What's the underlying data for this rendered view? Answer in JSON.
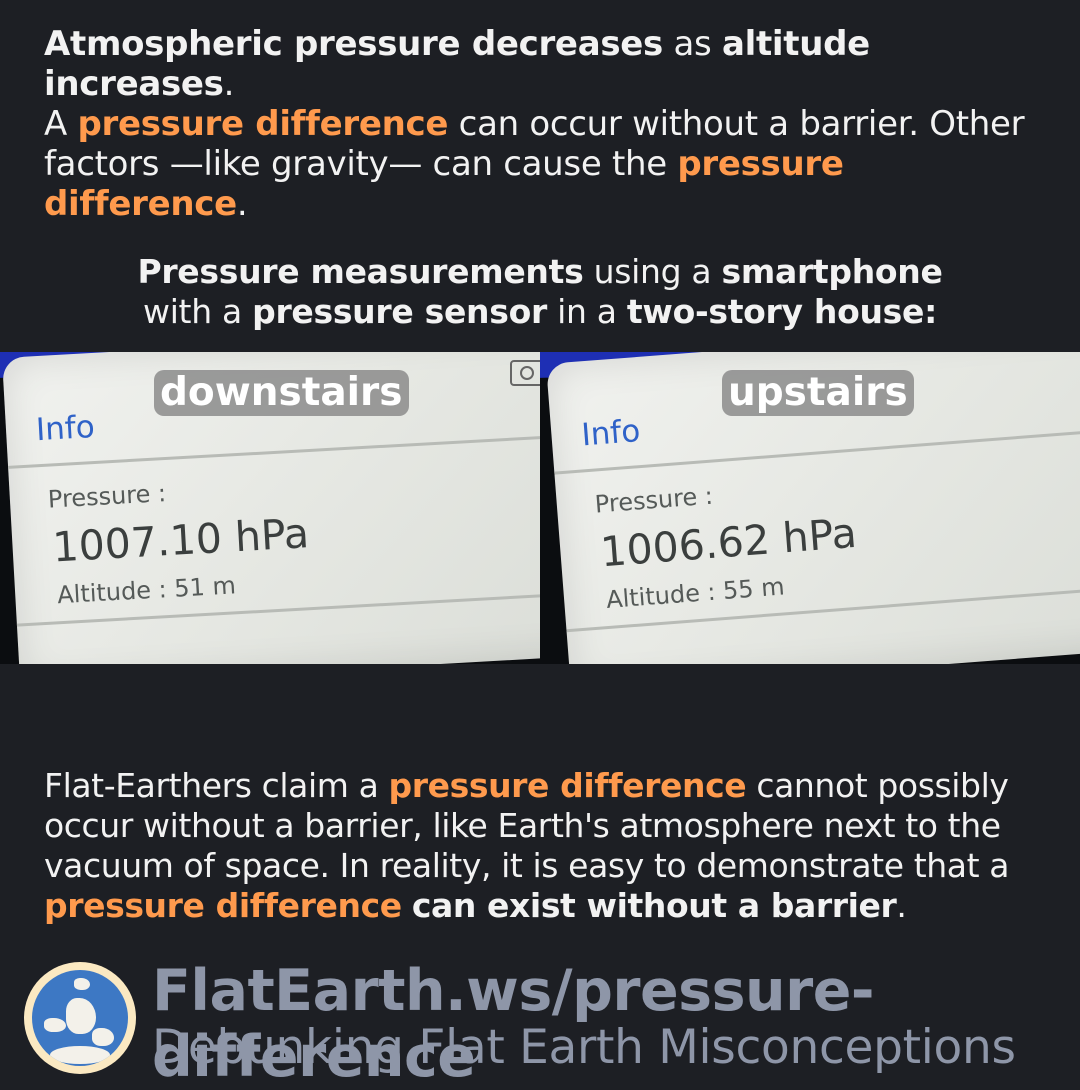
{
  "intro": {
    "s1": "Atmospheric pressure decreases",
    "s2": " as ",
    "s3": "altitude increases",
    "s4": ".",
    "s5": "A ",
    "s6": "pressure difference",
    "s7": " can occur without a barrier. Other factors —like gravity— can cause the ",
    "s8": "pressure difference",
    "s9": "."
  },
  "caption": {
    "s1": "Pressure measurements",
    "s2": " using a ",
    "s3": "smartphone",
    "s4": "with a ",
    "s5": "pressure sensor",
    "s6": " in a ",
    "s7": "two-story house:"
  },
  "photos": [
    {
      "tag": "downstairs",
      "info": "Info",
      "pressure_label": "Pressure :",
      "pressure_value": "1007.10 hPa",
      "altitude": "Altitude : 51 m"
    },
    {
      "tag": "upstairs",
      "info": "Info",
      "pressure_label": "Pressure :",
      "pressure_value": "1006.62 hPa",
      "altitude": "Altitude : 55 m"
    }
  ],
  "outro": {
    "s1": "Flat-Earthers claim a ",
    "s2": "pressure difference",
    "s3": " cannot possibly occur without a barrier, like Earth's atmosphere next to the vacuum of space. In reality, it is easy to demonstrate that a ",
    "s4": "pressure difference",
    "s5": " ",
    "s6": "can exist without a barrier",
    "s7": "."
  },
  "brand": {
    "url": "FlatEarth.ws/pressure-difference",
    "tagline": "Debunking Flat Earth Misconceptions",
    "logo_icon": "globe-logo-icon"
  },
  "colors": {
    "background": "#1d1f24",
    "highlight": "#ff9a4d",
    "brand_text": "#8e96a8"
  }
}
